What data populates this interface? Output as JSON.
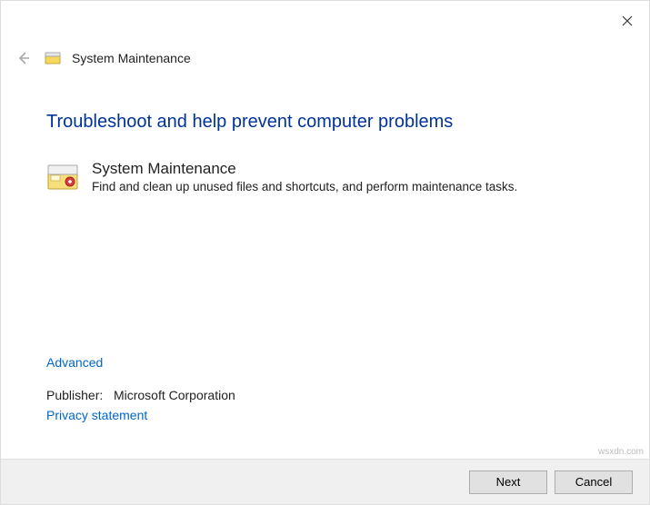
{
  "header": {
    "title": "System Maintenance"
  },
  "main": {
    "heading": "Troubleshoot and help prevent computer problems",
    "item": {
      "title": "System Maintenance",
      "description": "Find and clean up unused files and shortcuts, and perform maintenance tasks."
    }
  },
  "links": {
    "advanced": "Advanced",
    "privacy": "Privacy statement"
  },
  "publisher": {
    "label": "Publisher:",
    "value": "Microsoft Corporation"
  },
  "footer": {
    "next": "Next",
    "cancel": "Cancel"
  },
  "watermark": "wsxdn.com"
}
